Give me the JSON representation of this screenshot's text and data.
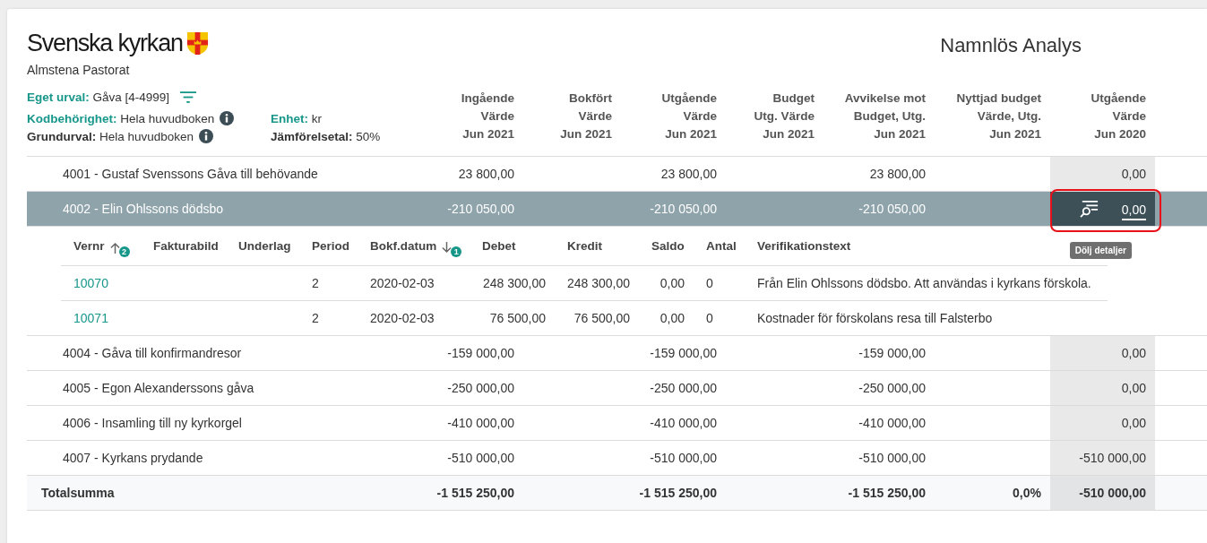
{
  "logo": {
    "name": "Svenska kyrkan",
    "subtitle": "Almstena Pastorat"
  },
  "title": "Namnlös Analys",
  "selection": {
    "label": "Eget urval:",
    "value": "Gåva [4-4999]"
  },
  "filters": [
    {
      "label": "Kodbehörighet:",
      "value": "Hela huvudboken",
      "info": true,
      "color": "#17978a"
    },
    {
      "label": "Enhet:",
      "value": "kr",
      "info": false,
      "color": "#17978a"
    },
    {
      "label": "Grundurval:",
      "value": "Hela huvudboken",
      "info": true,
      "color": "#333333"
    },
    {
      "label": "Jämförelsetal:",
      "value": "50%",
      "info": false,
      "color": "#333333"
    }
  ],
  "rows": [
    {
      "name": "4001 - Gustaf Svenssons Gåva till behövande",
      "selected": false
    },
    {
      "name": "4002 - Elin Ohlssons dödsbo",
      "selected": true,
      "highlighted": true,
      "tooltip": "Dölj detaljer",
      "details": [
        {
          "label": "Vernr",
          "kind": "link",
          "sorted": true,
          "ascending": true,
          "sort_rank": "2",
          "cells": [
            "10070",
            "10071"
          ]
        },
        {
          "label": "Fakturabild",
          "kind": "text",
          "sorted": false
        },
        {
          "label": "Underlag",
          "kind": "text",
          "sorted": false
        },
        {
          "label": "Period",
          "kind": "text",
          "sorted": false,
          "cells": [
            "2",
            "2"
          ]
        },
        {
          "label": "Bokf.datum",
          "kind": "text",
          "sorted": true,
          "ascending": false,
          "sort_rank": "1",
          "cells": [
            "2020-02-03",
            "2020-02-03"
          ]
        },
        {
          "label": "Debet",
          "kind": "number",
          "sorted": false,
          "cells": [
            "248 300,00",
            "76 500,00"
          ]
        },
        {
          "label": "Kredit",
          "kind": "number",
          "sorted": false,
          "cells": [
            "248 300,00",
            "76 500,00"
          ]
        },
        {
          "label": "Saldo",
          "kind": "number",
          "sorted": false,
          "cells": [
            "0,00",
            "0,00"
          ]
        },
        {
          "label": "Antal",
          "kind": "text",
          "sorted": false,
          "cells": [
            "0",
            "0"
          ]
        },
        {
          "label": "Verifikationstext",
          "kind": "text",
          "sorted": false,
          "cells": [
            "Från Elin Ohlssons dödsbo. Att användas i kyrkans förskola.",
            "Kostnader för förskolans resa till Falsterbo"
          ]
        }
      ]
    },
    {
      "name": "4004 - Gåva till konfirmandresor",
      "selected": false
    },
    {
      "name": "4005 - Egon Alexanderssons gåva",
      "selected": false
    },
    {
      "name": "4006 - Insamling till ny kyrkorgel",
      "selected": false
    },
    {
      "name": "4007 - Kyrkans prydande",
      "selected": false
    }
  ],
  "columns": [
    {
      "lines": [
        "Ingående",
        "Värde",
        "Jun 2021"
      ],
      "shaded": false,
      "values": [
        "23 800,00",
        "-210 050,00",
        "-159 000,00",
        "-250 000,00",
        "-410 000,00",
        "-510 000,00"
      ],
      "total": "-1 515 250,00"
    },
    {
      "lines": [
        "Bokfört",
        "Värde",
        "Jun 2021"
      ],
      "shaded": false
    },
    {
      "lines": [
        "Utgående",
        "Värde",
        "Jun 2021"
      ],
      "shaded": false,
      "values": [
        "23 800,00",
        "-210 050,00",
        "-159 000,00",
        "-250 000,00",
        "-410 000,00",
        "-510 000,00"
      ],
      "total": "-1 515 250,00"
    },
    {
      "lines": [
        "Budget",
        "Utg. Värde",
        "Jun 2021"
      ],
      "shaded": false
    },
    {
      "lines": [
        "Avvikelse mot",
        "Budget, Utg.",
        "Jun 2021"
      ],
      "shaded": false,
      "values": [
        "23 800,00",
        "-210 050,00",
        "-159 000,00",
        "-250 000,00",
        "-410 000,00",
        "-510 000,00"
      ],
      "total": "-1 515 250,00"
    },
    {
      "lines": [
        "Nyttjad budget",
        "Värde, Utg.",
        "Jun 2021"
      ],
      "shaded": false,
      "total": "0,0%"
    },
    {
      "lines": [
        "Utgående",
        "Värde",
        "Jun 2020"
      ],
      "shaded": true,
      "values": [
        "0,00",
        "0,00",
        "0,00",
        "0,00",
        "0,00",
        "-510 000,00"
      ],
      "total": "-510 000,00"
    }
  ],
  "total": {
    "label": "Totalsumma"
  }
}
